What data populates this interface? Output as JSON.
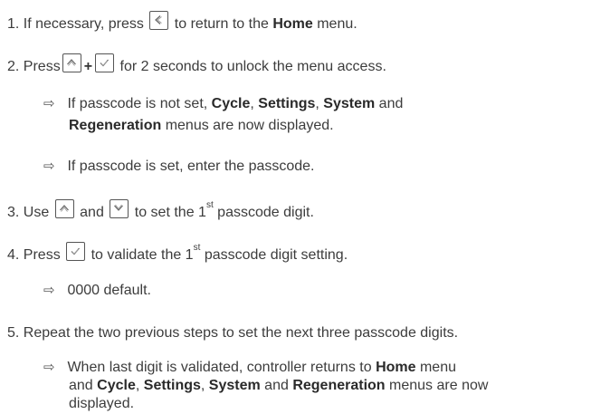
{
  "steps": [
    {
      "number": "1.",
      "before": "If necessary, press",
      "after": "to return to the",
      "bold": "Home",
      "end": "menu."
    },
    {
      "number": "2.",
      "before": "Press",
      "plus": "+",
      "after": "for 2 seconds to unlock the menu access."
    },
    {
      "number": "3.",
      "before": "Use",
      "mid": "and",
      "after": "to set the 1",
      "sup": "st",
      "end": "passcode digit."
    },
    {
      "number": "4.",
      "before": "Press",
      "after": "to validate the 1",
      "sup": "st",
      "end": "passcode digit setting."
    },
    {
      "number": "5.",
      "text": "Repeat the two previous steps to set the next three passcode digits."
    }
  ],
  "results": {
    "r1": {
      "arrow": "⇨",
      "a": "If passcode is not set,",
      "b1": "Cycle",
      "comma1": ",",
      "b2": "Settings",
      "comma2": ",",
      "b3": "System",
      "and": "and",
      "b4": "Regeneration",
      "end": "menus are now displayed."
    },
    "r2": {
      "arrow": "⇨",
      "text": "If passcode is set, enter the passcode."
    },
    "r3": {
      "arrow": "⇨",
      "text": "0000 default."
    },
    "r4": {
      "arrow": "⇨",
      "a": "When last digit is validated, controller returns to",
      "b1": "Home",
      "menu": "menu",
      "and1": "and",
      "b2": "Cycle",
      "comma1": ",",
      "b3": "Settings",
      "comma2": ",",
      "b4": "System",
      "and2": "and",
      "b5": "Regeneration",
      "end": "menus are now",
      "end2": "displayed."
    }
  },
  "icons": {
    "back": "back-key-icon",
    "up": "up-key-icon",
    "down": "down-key-icon",
    "ok": "ok-key-icon"
  }
}
